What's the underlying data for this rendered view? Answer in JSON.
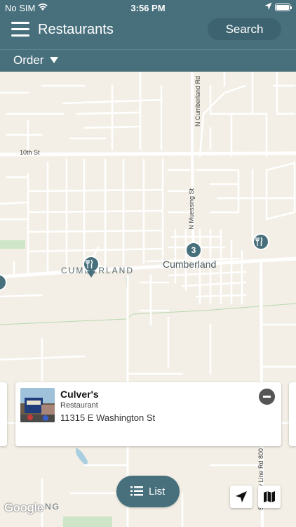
{
  "status_bar": {
    "carrier": "No SIM",
    "time": "3:56 PM"
  },
  "navbar": {
    "title": "Restaurants",
    "search_label": "Search"
  },
  "order_bar": {
    "label": "Order"
  },
  "map": {
    "roads": {
      "tenth_st": "10th St",
      "n_cumberland_rd": "N Cumberland Rd",
      "n_muessing_st": "N Muessing St",
      "line_rd": "S County Line Rd 800"
    },
    "places": {
      "cumberland_town": "CUMBERLAND",
      "cumberland": "Cumberland",
      "bottom_fragment": "NG"
    },
    "cluster_count": "3",
    "attribution": "Google"
  },
  "card": {
    "name": "Culver's",
    "type": "Restaurant",
    "address": "11315 E Washington St"
  },
  "list_button": {
    "label": "List"
  },
  "colors": {
    "accent": "#476f7c",
    "map_bg": "#f3efe6",
    "road": "#ffffff",
    "park": "#cfe5c7"
  },
  "icons": {
    "menu": "hamburger-icon",
    "list": "list-icon",
    "location": "location-arrow-icon",
    "map_mode": "map-icon",
    "restaurant_pin": "fork-knife-icon",
    "remove": "minus-circle-icon"
  }
}
